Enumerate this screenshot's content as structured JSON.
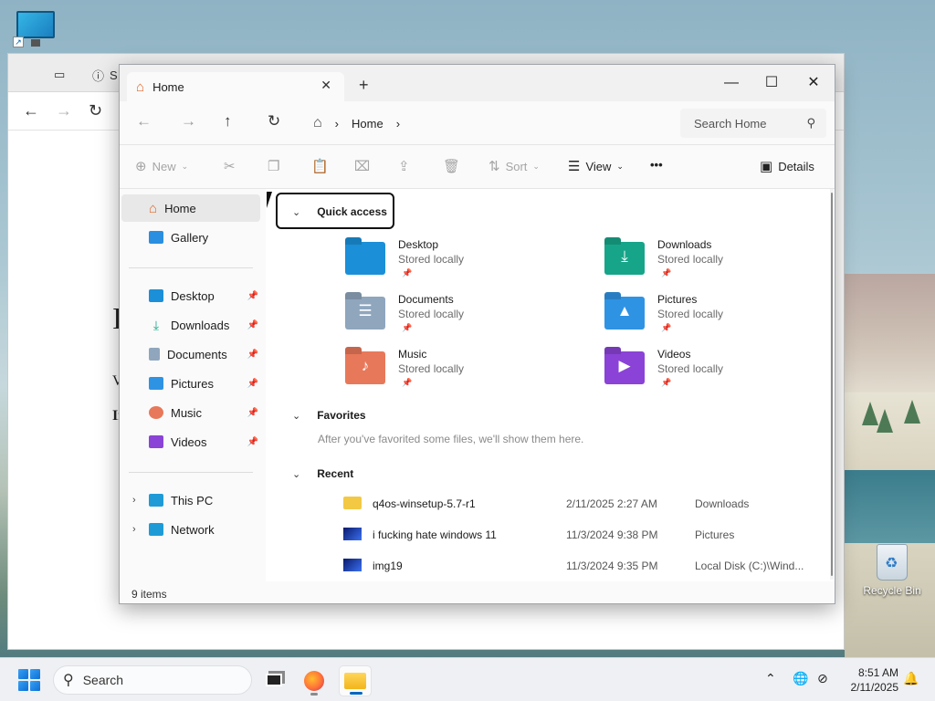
{
  "desktop": {
    "icons": [
      {
        "label": "Recycle Bin"
      }
    ]
  },
  "browser": {
    "tab_partial_label": "S",
    "content_letters": [
      "I",
      "V",
      "If"
    ]
  },
  "explorer": {
    "tab_title": "Home",
    "address": {
      "location": "Home"
    },
    "search_placeholder": "Search Home",
    "commands": {
      "new": "New",
      "sort": "Sort",
      "view": "View",
      "more": "•••",
      "details": "Details"
    },
    "nav": {
      "home": "Home",
      "gallery": "Gallery",
      "pinned": [
        "Desktop",
        "Downloads",
        "Documents",
        "Pictures",
        "Music",
        "Videos"
      ],
      "this_pc": "This PC",
      "network": "Network"
    },
    "quick_access": {
      "header": "Quick access",
      "tiles": [
        {
          "name": "Desktop",
          "sub": "Stored locally",
          "color": "#1b8fd8"
        },
        {
          "name": "Downloads",
          "sub": "Stored locally",
          "color": "#17a589"
        },
        {
          "name": "Documents",
          "sub": "Stored locally",
          "color": "#8fa6bd"
        },
        {
          "name": "Pictures",
          "sub": "Stored locally",
          "color": "#2f93e4"
        },
        {
          "name": "Music",
          "sub": "Stored locally",
          "color": "#e8785a"
        },
        {
          "name": "Videos",
          "sub": "Stored locally",
          "color": "#8a43d6"
        }
      ]
    },
    "favorites": {
      "header": "Favorites",
      "empty_text": "After you've favorited some files, we'll show them here."
    },
    "recent": {
      "header": "Recent",
      "rows": [
        {
          "name": "q4os-winsetup-5.7-r1",
          "date": "2/11/2025 2:27 AM",
          "location": "Downloads"
        },
        {
          "name": "i fucking hate windows 11",
          "date": "11/3/2024 9:38 PM",
          "location": "Pictures"
        },
        {
          "name": "img19",
          "date": "11/3/2024 9:35 PM",
          "location": "Local Disk (C:)\\Wind..."
        }
      ]
    },
    "status": "9 items"
  },
  "taskbar": {
    "search_label": "Search",
    "time": "8:51 AM",
    "date": "2/11/2025"
  },
  "colors": {
    "accent": "#0067c0",
    "selection": "#e8e8e8"
  }
}
